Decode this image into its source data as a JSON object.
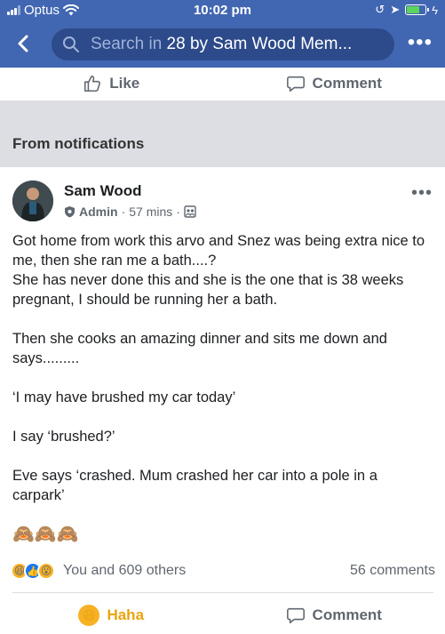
{
  "status_bar": {
    "carrier": "Optus",
    "time": "10:02 pm",
    "battery_color": "#5bd65b"
  },
  "nav": {
    "search_placeholder_prefix": "Search in ",
    "search_group": "28 by Sam Wood Mem...",
    "back_icon": "chevron-left-icon",
    "more_icon": "more-icon"
  },
  "prev_post_actions": {
    "like_label": "Like",
    "comment_label": "Comment"
  },
  "section": {
    "title": "From notifications"
  },
  "post": {
    "author": "Sam Wood",
    "role": "Admin",
    "time": "57 mins",
    "paragraphs": [
      "Got home from work this arvo and Snez was being extra nice to me, then she ran me a bath....?",
      "She has never done this and she is the one that is 38 weeks pregnant, I should be running her a bath.",
      "Then she cooks an amazing dinner and sits me down and says.........",
      "‘I may have brushed my car today’",
      "I say ‘brushed?’",
      "Eve says ‘crashed. Mum crashed her car into a pole in a carpark’",
      "🙈🙈🙈"
    ],
    "reactions_text": "You and 609 others",
    "comments_text": "56 comments",
    "reaction_action_label": "Haha",
    "comment_action_label": "Comment",
    "colors": {
      "haha": "#e9a40e",
      "like_blue": "#1877f2"
    }
  },
  "theme": {
    "brand": "#4267b2",
    "section_bg": "#dcdee3"
  }
}
